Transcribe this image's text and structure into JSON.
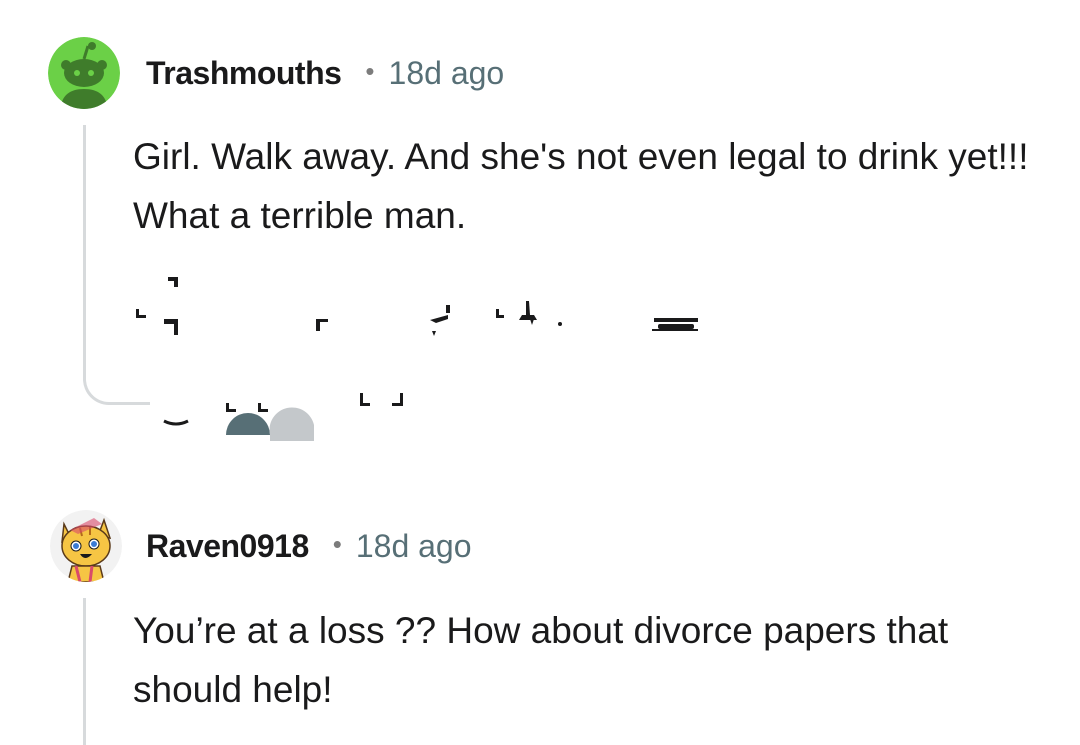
{
  "comments": [
    {
      "username": "Trashmouths",
      "separator": "•",
      "time": "18d ago",
      "text": "Girl. Walk away. And she's not even legal to drink yet!!! What a terrible man.",
      "avatar_icon": "reddit-snoo-avatar-icon",
      "avatar_color": "#6bd047"
    },
    {
      "username": "Raven0918",
      "separator": "•",
      "time": "18d ago",
      "text": "You’re at a loss ?? How about divorce papers that should help!",
      "avatar_icon": "cartoon-cat-avatar-icon",
      "avatar_color": "#f6c544"
    }
  ],
  "colors": {
    "username": "#1a1a1b",
    "time": "#576f76",
    "thread_line": "#d7dadc"
  }
}
